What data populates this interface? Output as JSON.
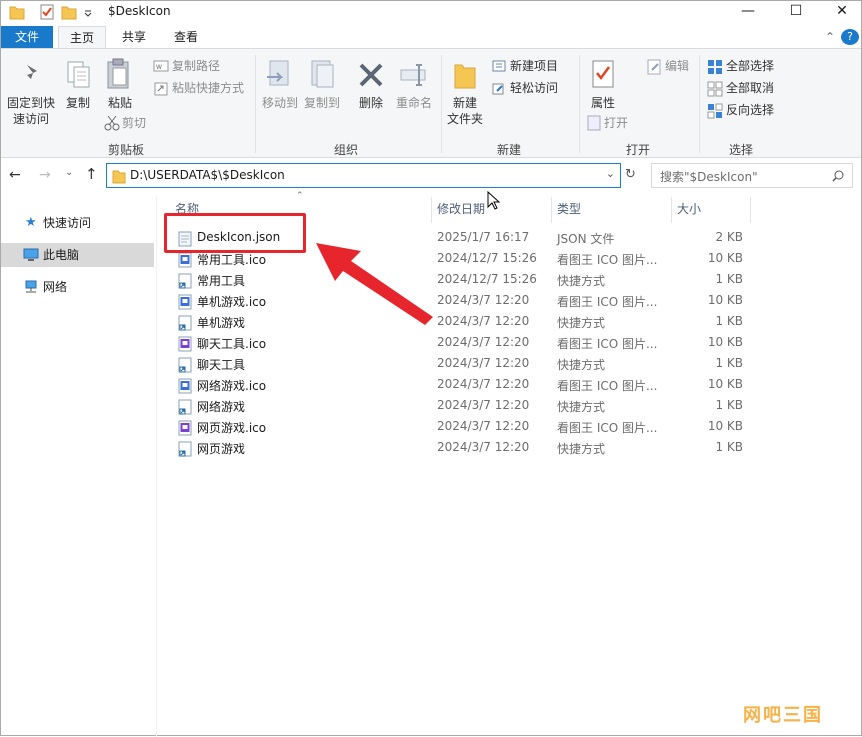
{
  "window": {
    "title": "$DeskIcon"
  },
  "controls": {
    "minimize": "—",
    "maximize": "☐",
    "close": "✕",
    "help": "?",
    "collapse": "⌃"
  },
  "tabs": {
    "file": "文件",
    "home": "主页",
    "share": "共享",
    "view": "查看"
  },
  "ribbon": {
    "clipboard": {
      "label": "剪贴板",
      "pin": "固定到快\n速访问",
      "copy": "复制",
      "paste": "粘贴",
      "copy_path": "复制路径",
      "paste_shortcut": "粘贴快捷方式",
      "cut": "剪切"
    },
    "organize": {
      "label": "组织",
      "move_to": "移动到",
      "copy_to": "复制到",
      "delete": "删除",
      "rename": "重命名"
    },
    "new": {
      "label": "新建",
      "new_folder": "新建\n文件夹",
      "new_item": "新建项目",
      "easy_access": "轻松访问"
    },
    "open": {
      "label": "打开",
      "properties": "属性",
      "open": "打开",
      "edit": "编辑"
    },
    "select": {
      "label": "选择",
      "select_all": "全部选择",
      "select_none": "全部取消",
      "invert": "反向选择"
    }
  },
  "address": {
    "path": "D:\\USERDATA$\\$DeskIcon",
    "search_placeholder": "搜索\"$DeskIcon\""
  },
  "nav": {
    "quick_access": "快速访问",
    "this_pc": "此电脑",
    "network": "网络"
  },
  "columns": {
    "name": "名称",
    "date": "修改日期",
    "type": "类型",
    "size": "大小"
  },
  "files": [
    {
      "name": "DeskIcon.json",
      "date": "2025/1/7 16:17",
      "type": "JSON 文件",
      "size": "2 KB",
      "icon": "json-file-icon"
    },
    {
      "name": "常用工具.ico",
      "date": "2024/12/7 15:26",
      "type": "看图王 ICO 图片...",
      "size": "10 KB",
      "icon": "ico-file-icon"
    },
    {
      "name": "常用工具",
      "date": "2024/12/7 15:26",
      "type": "快捷方式",
      "size": "1 KB",
      "icon": "shortcut-icon"
    },
    {
      "name": "单机游戏.ico",
      "date": "2024/3/7 12:20",
      "type": "看图王 ICO 图片...",
      "size": "10 KB",
      "icon": "ico-file-icon"
    },
    {
      "name": "单机游戏",
      "date": "2024/3/7 12:20",
      "type": "快捷方式",
      "size": "1 KB",
      "icon": "shortcut-icon"
    },
    {
      "name": "聊天工具.ico",
      "date": "2024/3/7 12:20",
      "type": "看图王 ICO 图片...",
      "size": "10 KB",
      "icon": "ico-file-icon"
    },
    {
      "name": "聊天工具",
      "date": "2024/3/7 12:20",
      "type": "快捷方式",
      "size": "1 KB",
      "icon": "shortcut-icon"
    },
    {
      "name": "网络游戏.ico",
      "date": "2024/3/7 12:20",
      "type": "看图王 ICO 图片...",
      "size": "10 KB",
      "icon": "ico-file-icon"
    },
    {
      "name": "网络游戏",
      "date": "2024/3/7 12:20",
      "type": "快捷方式",
      "size": "1 KB",
      "icon": "shortcut-icon"
    },
    {
      "name": "网页游戏.ico",
      "date": "2024/3/7 12:20",
      "type": "看图王 ICO 图片...",
      "size": "10 KB",
      "icon": "ico-file-icon"
    },
    {
      "name": "网页游戏",
      "date": "2024/3/7 12:20",
      "type": "快捷方式",
      "size": "1 KB",
      "icon": "shortcut-icon"
    }
  ],
  "watermark": "网吧三国",
  "colors": {
    "accent": "#1979ca",
    "highlight": "#e6262c",
    "ico_blue": "#3a6fd8",
    "ico_purple": "#7b3fd1"
  }
}
